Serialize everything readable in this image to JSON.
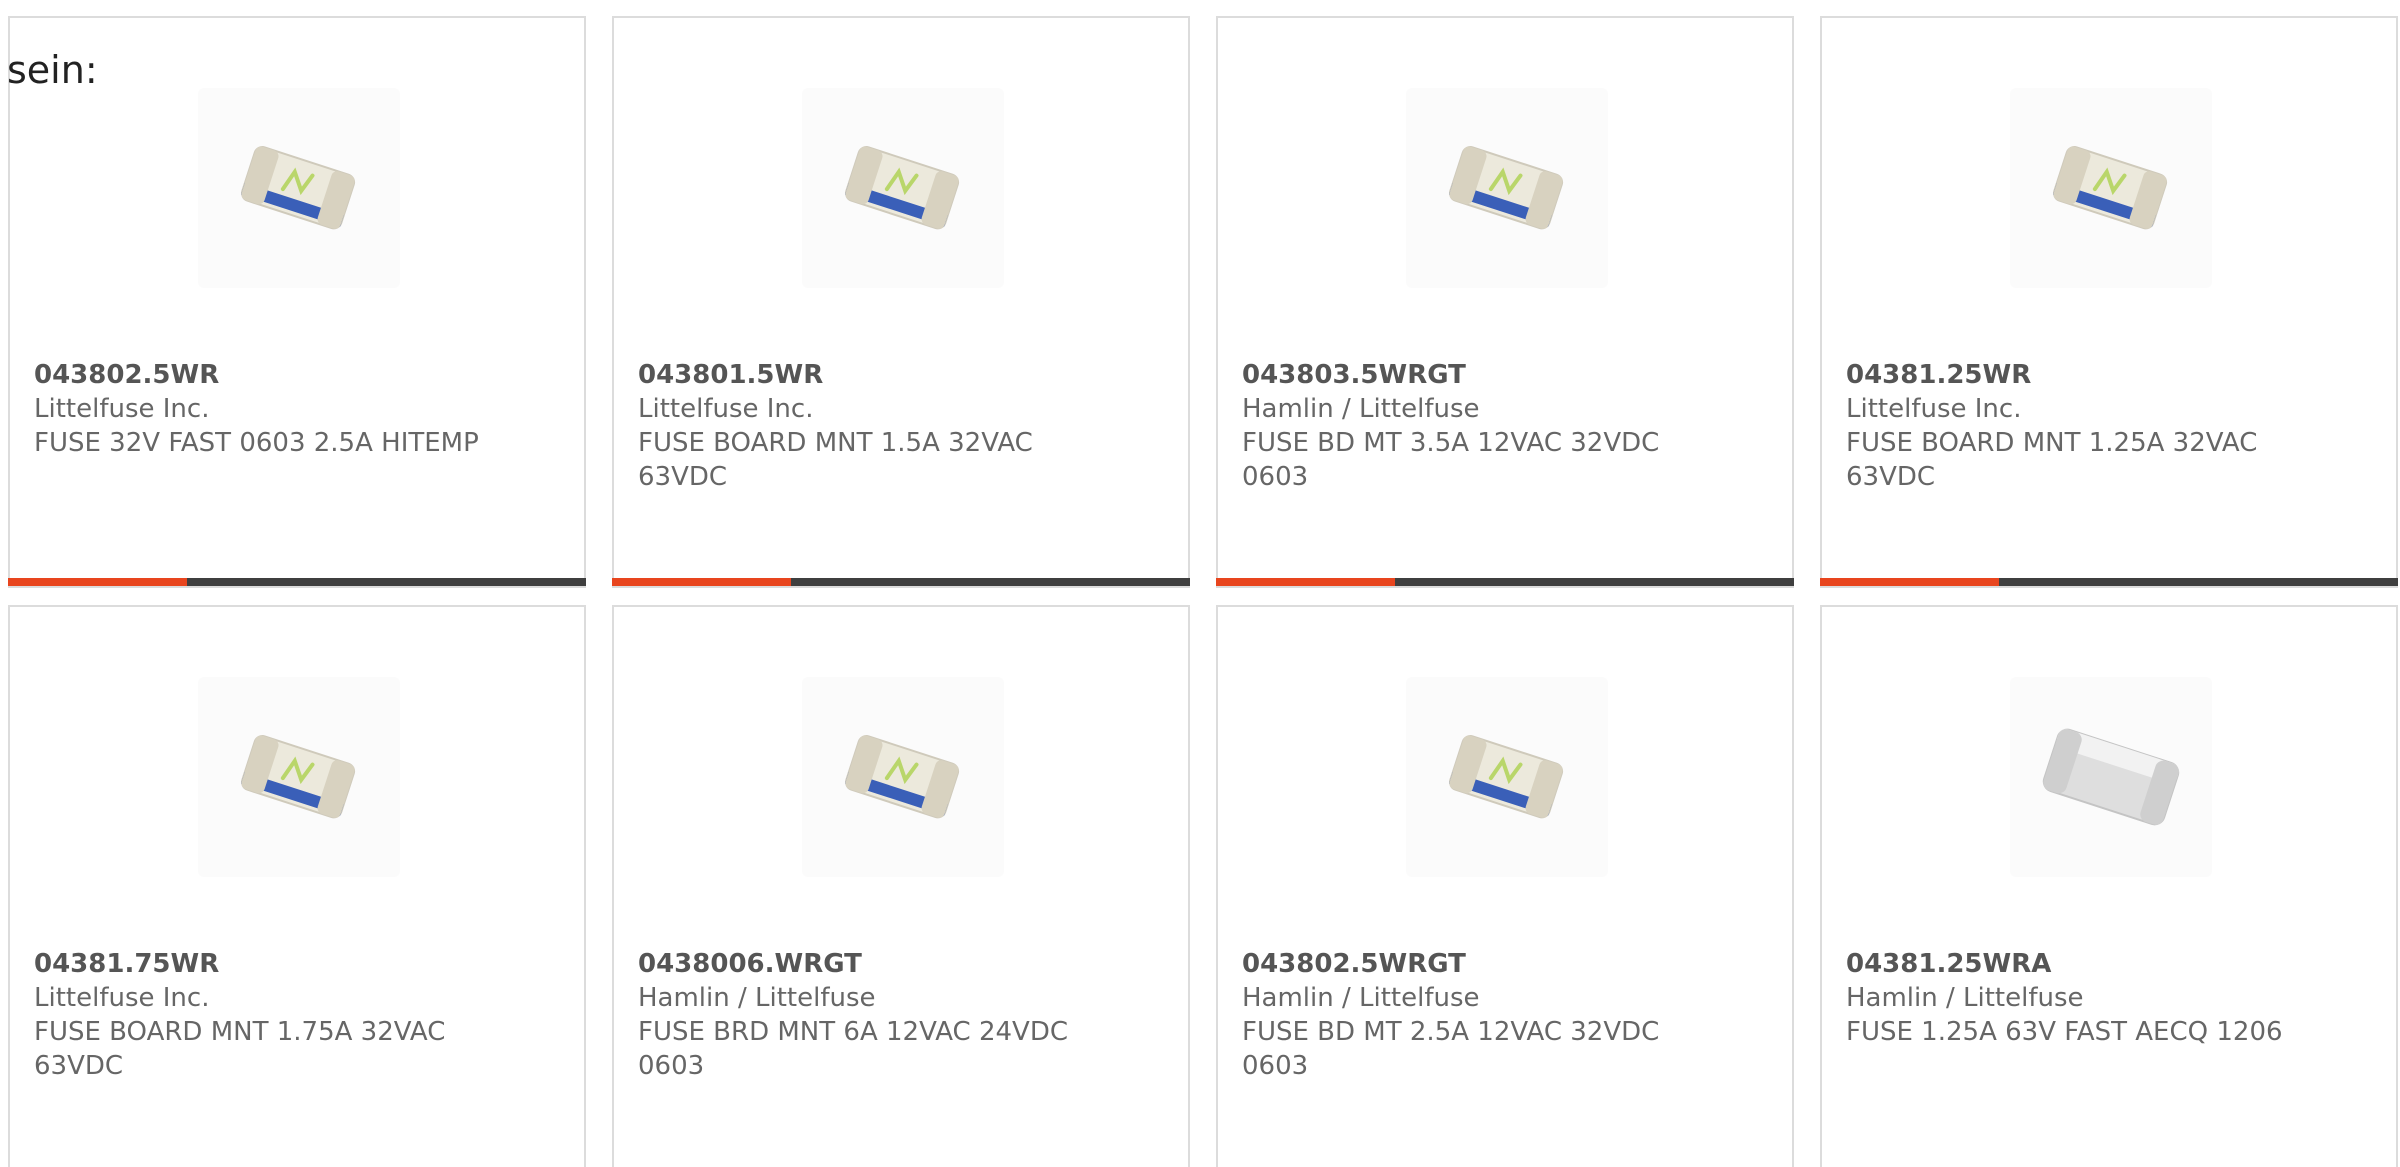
{
  "intro_text": "sein:",
  "colors": {
    "accent": "#e8451e",
    "bar_track": "#3f3f3f",
    "text": "#666666"
  },
  "products": [
    {
      "part_number": "043802.5WR",
      "manufacturer": "Littelfuse Inc.",
      "description": "FUSE 32V FAST 0603 2.5A HITEMP",
      "image_icon": "smd-fuse-marked-icon",
      "progress": 0.31
    },
    {
      "part_number": "043801.5WR",
      "manufacturer": "Littelfuse Inc.",
      "description": "FUSE BOARD MNT 1.5A 32VAC 63VDC",
      "image_icon": "smd-fuse-marked-icon",
      "progress": 0.31
    },
    {
      "part_number": "043803.5WRGT",
      "manufacturer": "Hamlin / Littelfuse",
      "description": "FUSE BD MT 3.5A 12VAC 32VDC 0603",
      "image_icon": "smd-fuse-marked-icon",
      "progress": 0.31
    },
    {
      "part_number": "04381.25WR",
      "manufacturer": "Littelfuse Inc.",
      "description": "FUSE BOARD MNT 1.25A 32VAC 63VDC",
      "image_icon": "smd-fuse-marked-icon",
      "progress": 0.31
    },
    {
      "part_number": "04381.75WR",
      "manufacturer": "Littelfuse Inc.",
      "description": "FUSE BOARD MNT 1.75A 32VAC 63VDC",
      "image_icon": "smd-fuse-marked-icon",
      "progress": null
    },
    {
      "part_number": "0438006.WRGT",
      "manufacturer": "Hamlin / Littelfuse",
      "description": "FUSE BRD MNT 6A 12VAC 24VDC 0603",
      "image_icon": "smd-fuse-marked-icon",
      "progress": null
    },
    {
      "part_number": "043802.5WRGT",
      "manufacturer": "Hamlin / Littelfuse",
      "description": "FUSE BD MT 2.5A 12VAC 32VDC 0603",
      "image_icon": "smd-fuse-marked-icon",
      "progress": null
    },
    {
      "part_number": "04381.25WRA",
      "manufacturer": "Hamlin / Littelfuse",
      "description": "FUSE 1.25A 63V FAST AECQ 1206",
      "image_icon": "smd-fuse-plain-icon",
      "progress": null
    }
  ]
}
